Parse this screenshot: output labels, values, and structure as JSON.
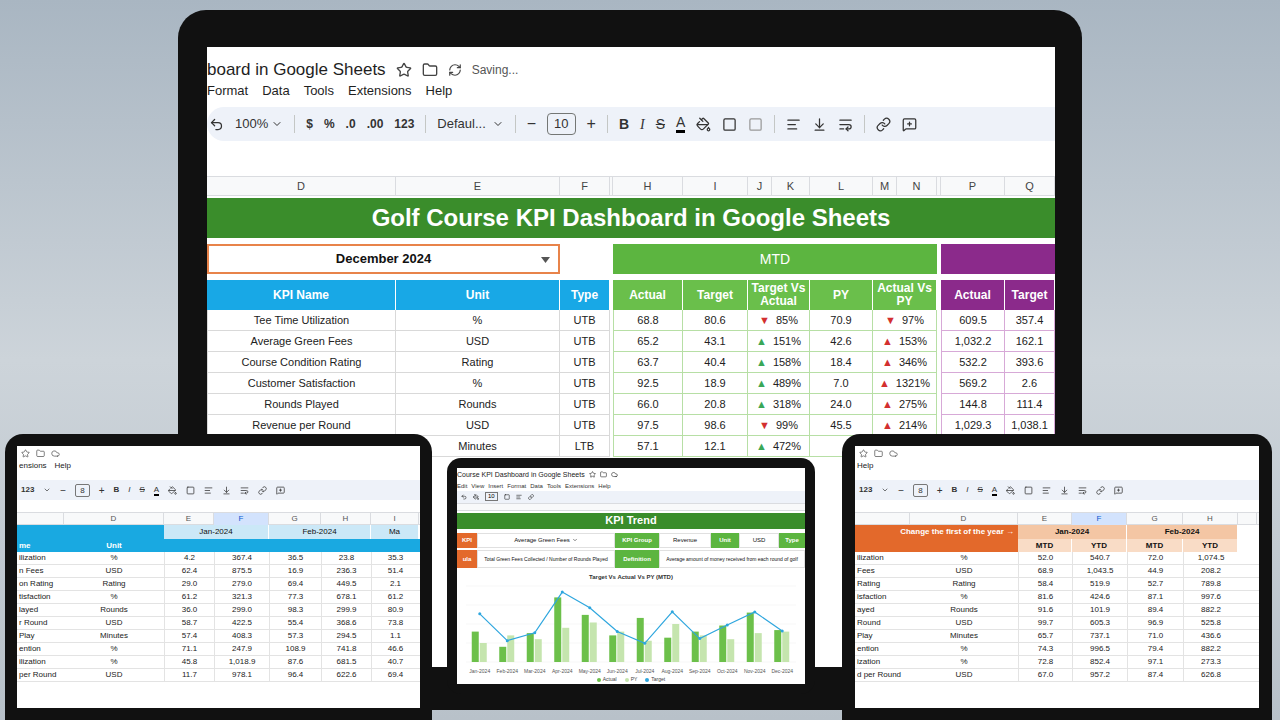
{
  "main_screen": {
    "doc_title": "board in Google Sheets",
    "status": "Saving...",
    "menu": [
      "Format",
      "Data",
      "Tools",
      "Extensions",
      "Help"
    ],
    "toolbar": {
      "zoom": "100%",
      "items": [
        "$",
        "%",
        ".0",
        ".00",
        "123"
      ],
      "font": "Defaul...",
      "minus": "−",
      "font_size": "10",
      "plus": "+",
      "bold": "B",
      "italic": "I",
      "strike": "S",
      "text_color": "A"
    },
    "column_headers": [
      "D",
      "E",
      "F",
      "",
      "H",
      "I",
      "J",
      "K",
      "L",
      "M",
      "N",
      "",
      "P",
      "Q"
    ],
    "banner": "Golf Course KPI Dashboard in Google Sheets",
    "month": "December 2024",
    "mtd_label": "MTD",
    "headers": [
      "KPI Name",
      "Unit",
      "Type",
      "",
      "Actual",
      "Target",
      "Target Vs Actual",
      "PY",
      "Actual Vs PY",
      "",
      "Actual",
      "Target"
    ],
    "rows": [
      {
        "kpi": "Tee Time Utilization",
        "unit": "%",
        "type": "UTB",
        "actual": "68.8",
        "target": "80.6",
        "tva": {
          "arrow": "▼",
          "value": "85%",
          "color": "#d32f2f"
        },
        "py": "70.9",
        "avspy": {
          "arrow": "▼",
          "value": "97%",
          "color": "#d32f2f"
        },
        "ytd_actual": "609.5",
        "ytd_target": "357.4"
      },
      {
        "kpi": "Average Green Fees",
        "unit": "USD",
        "type": "UTB",
        "actual": "65.2",
        "target": "43.1",
        "tva": {
          "arrow": "▲",
          "value": "151%",
          "color": "#3aa757"
        },
        "py": "42.6",
        "avspy": {
          "arrow": "▲",
          "value": "153%",
          "color": "#d32f2f"
        },
        "ytd_actual": "1,032.2",
        "ytd_target": "162.1"
      },
      {
        "kpi": "Course Condition Rating",
        "unit": "Rating",
        "type": "UTB",
        "actual": "63.7",
        "target": "40.4",
        "tva": {
          "arrow": "▲",
          "value": "158%",
          "color": "#3aa757"
        },
        "py": "18.4",
        "avspy": {
          "arrow": "▲",
          "value": "346%",
          "color": "#d32f2f"
        },
        "ytd_actual": "532.2",
        "ytd_target": "393.6"
      },
      {
        "kpi": "Customer Satisfaction",
        "unit": "%",
        "type": "UTB",
        "actual": "92.5",
        "target": "18.9",
        "tva": {
          "arrow": "▲",
          "value": "489%",
          "color": "#3aa757"
        },
        "py": "7.0",
        "avspy": {
          "arrow": "▲",
          "value": "1321%",
          "color": "#d32f2f"
        },
        "ytd_actual": "569.2",
        "ytd_target": "2.6"
      },
      {
        "kpi": "Rounds Played",
        "unit": "Rounds",
        "type": "UTB",
        "actual": "66.0",
        "target": "20.8",
        "tva": {
          "arrow": "▲",
          "value": "318%",
          "color": "#3aa757"
        },
        "py": "24.0",
        "avspy": {
          "arrow": "▲",
          "value": "275%",
          "color": "#d32f2f"
        },
        "ytd_actual": "144.8",
        "ytd_target": "111.4"
      },
      {
        "kpi": "Revenue per Round",
        "unit": "USD",
        "type": "UTB",
        "actual": "97.5",
        "target": "98.6",
        "tva": {
          "arrow": "▼",
          "value": "99%",
          "color": "#d32f2f"
        },
        "py": "45.5",
        "avspy": {
          "arrow": "▲",
          "value": "214%",
          "color": "#d32f2f"
        },
        "ytd_actual": "1,029.3",
        "ytd_target": "1,038.1"
      },
      {
        "kpi": "",
        "unit": "Minutes",
        "type": "LTB",
        "actual": "57.1",
        "target": "12.1",
        "tva": {
          "arrow": "▲",
          "value": "472%",
          "color": "#3aa757"
        },
        "py": "",
        "avspy": null,
        "ytd_actual": "",
        "ytd_target": ""
      }
    ]
  },
  "left_laptop": {
    "menu": [
      "ensions",
      "Help"
    ],
    "toolbar": {
      "format": "123",
      "minus": "−",
      "font_size": "8",
      "plus": "+",
      "bold": "B",
      "italic": "I",
      "strike": "S",
      "text_color": "A"
    },
    "column_headers": [
      {
        "label": "",
        "selected": false
      },
      {
        "label": "D",
        "selected": false
      },
      {
        "label": "E",
        "selected": false
      },
      {
        "label": "F",
        "selected": true
      },
      {
        "label": "G",
        "selected": false
      },
      {
        "label": "H",
        "selected": false
      },
      {
        "label": "I",
        "selected": false
      }
    ],
    "month_headers": [
      "Jan-2024",
      "Feb-2024",
      "Ma"
    ],
    "label_headers": [
      "me",
      "Unit"
    ],
    "rows": [
      {
        "name": "ilization",
        "unit": "%",
        "values": [
          "4.2",
          "367.4",
          "36.5",
          "23.8",
          "35.3"
        ]
      },
      {
        "name": "n Fees",
        "unit": "USD",
        "values": [
          "62.4",
          "875.5",
          "16.9",
          "236.3",
          "51.4"
        ]
      },
      {
        "name": "on Rating",
        "unit": "Rating",
        "values": [
          "29.0",
          "279.0",
          "69.4",
          "449.5",
          "2.1"
        ]
      },
      {
        "name": "tisfaction",
        "unit": "%",
        "values": [
          "61.2",
          "321.3",
          "77.3",
          "678.1",
          "61.2"
        ]
      },
      {
        "name": "layed",
        "unit": "Rounds",
        "values": [
          "36.0",
          "299.0",
          "98.3",
          "299.9",
          "80.9"
        ]
      },
      {
        "name": "r Round",
        "unit": "USD",
        "values": [
          "58.7",
          "422.5",
          "55.4",
          "368.6",
          "73.8"
        ]
      },
      {
        "name": "Play",
        "unit": "Minutes",
        "values": [
          "57.4",
          "408.3",
          "57.3",
          "294.5",
          "1.1"
        ]
      },
      {
        "name": "ention",
        "unit": "%",
        "values": [
          "71.1",
          "247.9",
          "108.9",
          "741.8",
          "46.6"
        ]
      },
      {
        "name": "ilization",
        "unit": "%",
        "values": [
          "45.8",
          "1,018.9",
          "87.6",
          "681.5",
          "40.7"
        ]
      },
      {
        "name": "per Round",
        "unit": "USD",
        "values": [
          "11.7",
          "978.1",
          "96.4",
          "622.6",
          "69.4"
        ]
      }
    ]
  },
  "right_laptop": {
    "menu": [
      "Help"
    ],
    "toolbar": {
      "format": "123",
      "minus": "−",
      "font_size": "8",
      "plus": "+",
      "bold": "B",
      "italic": "I",
      "strike": "S",
      "text_color": "A"
    },
    "column_headers": [
      {
        "label": "",
        "selected": false
      },
      {
        "label": "D",
        "selected": false
      },
      {
        "label": "E",
        "selected": false
      },
      {
        "label": "F",
        "selected": true
      },
      {
        "label": "G",
        "selected": false
      },
      {
        "label": "H",
        "selected": false
      },
      {
        "label": "",
        "selected": false
      }
    ],
    "note": "Change the first of the year →",
    "month_headers": [
      "Jan-2024",
      "Feb-2024"
    ],
    "sub_headers": [
      "MTD",
      "YTD",
      "MTD",
      "YTD"
    ],
    "rows": [
      {
        "name": "ilization",
        "unit": "%",
        "values": [
          "52.0",
          "540.7",
          "72.0",
          "1,074.5"
        ]
      },
      {
        "name": "Fees",
        "unit": "USD",
        "values": [
          "68.9",
          "1,043.5",
          "44.9",
          "208.2"
        ]
      },
      {
        "name": "Rating",
        "unit": "Rating",
        "values": [
          "58.4",
          "519.9",
          "52.7",
          "789.8"
        ]
      },
      {
        "name": "isfaction",
        "unit": "%",
        "values": [
          "81.6",
          "424.6",
          "87.1",
          "997.6"
        ]
      },
      {
        "name": "ayed",
        "unit": "Rounds",
        "values": [
          "91.6",
          "101.9",
          "89.4",
          "882.2"
        ]
      },
      {
        "name": "Round",
        "unit": "USD",
        "values": [
          "99.7",
          "605.3",
          "96.9",
          "525.8"
        ]
      },
      {
        "name": "Play",
        "unit": "Minutes",
        "values": [
          "65.7",
          "737.1",
          "71.0",
          "436.6"
        ]
      },
      {
        "name": "ention",
        "unit": "%",
        "values": [
          "74.3",
          "996.5",
          "79.4",
          "882.2"
        ]
      },
      {
        "name": "ization",
        "unit": "%",
        "values": [
          "72.8",
          "852.4",
          "97.1",
          "273.3"
        ]
      },
      {
        "name": "d per Round",
        "unit": "USD",
        "values": [
          "67.0",
          "957.2",
          "87.4",
          "626.8"
        ]
      }
    ]
  },
  "center_laptop": {
    "doc_title": "Course KPI Dashboard in Google Sheets",
    "menu": [
      "Edit",
      "View",
      "Insert",
      "Format",
      "Data",
      "Tools",
      "Extensions",
      "Help"
    ],
    "toolbar": {
      "font_size": "10"
    },
    "banner": "KPI Trend",
    "field_rows": [
      [
        {
          "text": "KPI",
          "kind": "label",
          "color": "#e3692b"
        },
        {
          "text": "Average Green Fees",
          "kind": "dropdown",
          "color": "#ffffff"
        },
        {
          "text": "KPI Group",
          "kind": "label",
          "color": "#5cb540"
        },
        {
          "text": "Revenue",
          "kind": "value",
          "color": "#ffffff"
        },
        {
          "text": "Unit",
          "kind": "label",
          "color": "#5cb540"
        },
        {
          "text": "USD",
          "kind": "value",
          "color": "#ffffff"
        },
        {
          "text": "Type",
          "kind": "label",
          "color": "#5cb540"
        }
      ],
      [
        {
          "text": "ula",
          "kind": "label",
          "color": "#e3692b"
        },
        {
          "text": "Total Green Fees Collected / Number of Rounds Played",
          "kind": "value",
          "color": "#ffffff"
        },
        {
          "text": "Definition",
          "kind": "label",
          "color": "#5cb540"
        },
        {
          "text": "Average amount of money received from each round of golf",
          "kind": "value",
          "color": "#ffffff"
        }
      ]
    ],
    "chart": {
      "title": "Target Vs Actual Vs PY (MTD)",
      "months": [
        "Jan-2024",
        "Feb-2024",
        "Mar-2024",
        "Apr-2024",
        "May-2024",
        "Jun-2024",
        "Jul-2024",
        "Aug-2024",
        "Sep-2024",
        "Oct-2024",
        "Nov-2024",
        "Dec-2024"
      ],
      "max": 100,
      "series": [
        {
          "name": "Actual",
          "kind": "bar",
          "color": "#6cc04a",
          "values": [
            40,
            20,
            38,
            85,
            62,
            35,
            58,
            32,
            40,
            48,
            65,
            42
          ]
        },
        {
          "name": "PY",
          "kind": "bar",
          "color": "#c5e5ae",
          "values": [
            25,
            35,
            30,
            45,
            52,
            40,
            28,
            50,
            35,
            30,
            38,
            40
          ]
        },
        {
          "name": "Target",
          "kind": "line",
          "color": "#2ea6de",
          "values": [
            63.4,
            28.1,
            38.5,
            92,
            71.4,
            40.2,
            24.6,
            66.1,
            30.8,
            48.6,
            65.9,
            40.7
          ]
        }
      ]
    }
  }
}
